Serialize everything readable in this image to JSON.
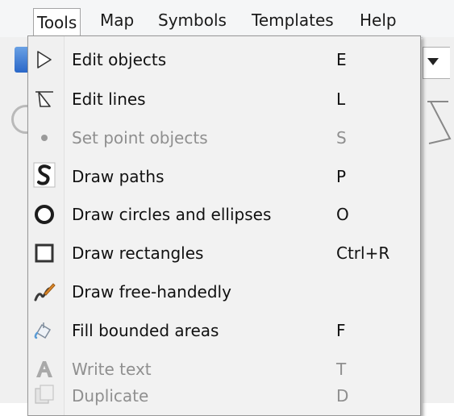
{
  "menubar": {
    "items": [
      {
        "label": "Tools"
      },
      {
        "label": "Map"
      },
      {
        "label": "Symbols"
      },
      {
        "label": "Templates"
      },
      {
        "label": "Help"
      }
    ],
    "active_item": "Tools"
  },
  "tools_menu": {
    "items": [
      {
        "label": "Edit objects",
        "shortcut": "E",
        "icon": "edit-objects-arrow-icon",
        "enabled": true
      },
      {
        "label": "Edit lines",
        "shortcut": "L",
        "icon": "edit-lines-arrow-icon",
        "enabled": true
      },
      {
        "label": "Set point objects",
        "shortcut": "S",
        "icon": "point-dot-icon",
        "enabled": false
      },
      {
        "label": "Draw paths",
        "shortcut": "P",
        "icon": "path-s-icon",
        "enabled": true
      },
      {
        "label": "Draw circles and ellipses",
        "shortcut": "O",
        "icon": "circle-icon",
        "enabled": true
      },
      {
        "label": "Draw rectangles",
        "shortcut": "Ctrl+R",
        "icon": "rectangle-icon",
        "enabled": true
      },
      {
        "label": "Draw free-handedly",
        "shortcut": "",
        "icon": "freehand-brush-icon",
        "enabled": true
      },
      {
        "label": "Fill bounded areas",
        "shortcut": "F",
        "icon": "fill-bucket-icon",
        "enabled": true
      },
      {
        "label": "Write text",
        "shortcut": "T",
        "icon": "text-a-icon",
        "enabled": false
      },
      {
        "label": "Duplicate",
        "shortcut": "D",
        "icon": "duplicate-icon",
        "enabled": false
      }
    ]
  },
  "colors": {
    "menu_background": "#f2f2f2",
    "disabled_text": "#8f8f8f",
    "icon_dark": "#222222",
    "brush_orange": "#e0892a"
  }
}
